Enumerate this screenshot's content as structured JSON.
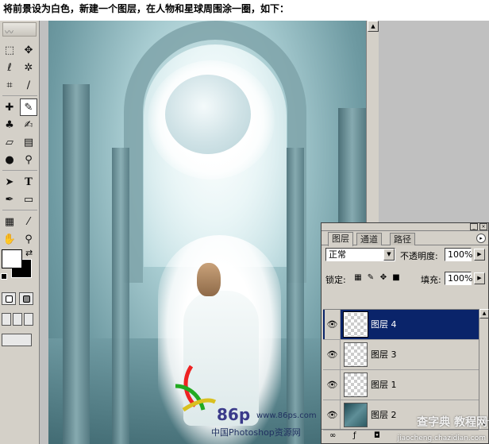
{
  "caption": "将前景设为白色，新建一个图层，在人物和星球周围涂一圈，如下：",
  "toolbox": {
    "tools": [
      "rect-marquee-icon",
      "move-icon",
      "lasso-icon",
      "magic-wand-icon",
      "crop-icon",
      "slice-icon",
      "healing-brush-icon",
      "brush-icon",
      "clone-stamp-icon",
      "history-brush-icon",
      "eraser-icon",
      "gradient-icon",
      "blur-icon",
      "dodge-icon",
      "path-select-icon",
      "type-icon",
      "pen-icon",
      "shape-icon",
      "notes-icon",
      "eyedropper-icon",
      "hand-icon",
      "zoom-icon"
    ],
    "type_tool_glyph": "T",
    "foreground_color": "#ffffff",
    "background_color": "#000000"
  },
  "watermark": {
    "brand": "86p",
    "url": "www.86ps.com",
    "name_cn": "中国Photoshop资源网"
  },
  "layers_panel": {
    "tabs": [
      "图层",
      "通道",
      "路径"
    ],
    "blend_mode": "正常",
    "opacity_label": "不透明度:",
    "opacity_value": "100%",
    "lock_label": "锁定:",
    "fill_label": "填充:",
    "fill_value": "100%",
    "layers": [
      {
        "name": "图层 4",
        "selected": true,
        "thumb": "transparent"
      },
      {
        "name": "图层 3",
        "selected": false,
        "thumb": "transparent"
      },
      {
        "name": "图层 1",
        "selected": false,
        "thumb": "transparent"
      },
      {
        "name": "图层 2",
        "selected": false,
        "thumb": "image"
      }
    ],
    "selection_color": "#0a246a"
  },
  "site_watermark": {
    "text": "查字典 教程网",
    "url": "jiaocheng.chazidian.com"
  }
}
